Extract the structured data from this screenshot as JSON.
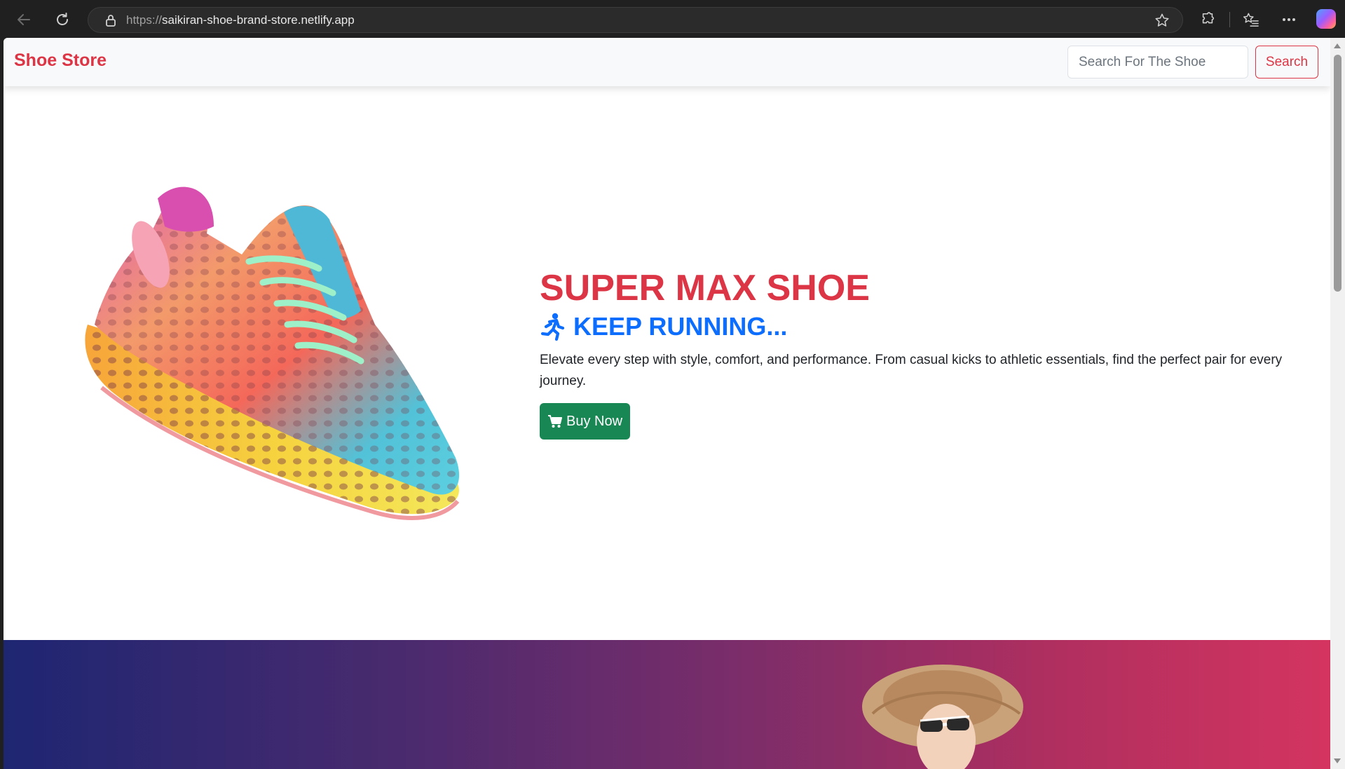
{
  "browser": {
    "url_scheme": "https://",
    "url_host": "saikiran-shoe-brand-store.netlify.app"
  },
  "navbar": {
    "brand": "Shoe Store",
    "search_placeholder": "Search For The Shoe",
    "search_button": "Search"
  },
  "hero": {
    "title": "SUPER MAX SHOE",
    "subtitle": "KEEP RUNNING...",
    "description": "Elevate every step with style, comfort, and performance. From casual kicks to athletic essentials, find the perfect pair for every journey.",
    "buy_button": "Buy Now"
  },
  "colors": {
    "brand_red": "#dc3545",
    "primary_blue": "#0d6efd",
    "success_green": "#198754",
    "gradient_start": "#1e2672",
    "gradient_end": "#d43460"
  },
  "icons": {
    "back": "arrow-left-icon",
    "reload": "reload-icon",
    "lock": "lock-icon",
    "favorite": "star-icon",
    "extensions": "puzzle-icon",
    "collections": "favorites-list-icon",
    "menu": "more-icon",
    "subtitle": "running-person-icon",
    "buy": "cart-icon"
  }
}
